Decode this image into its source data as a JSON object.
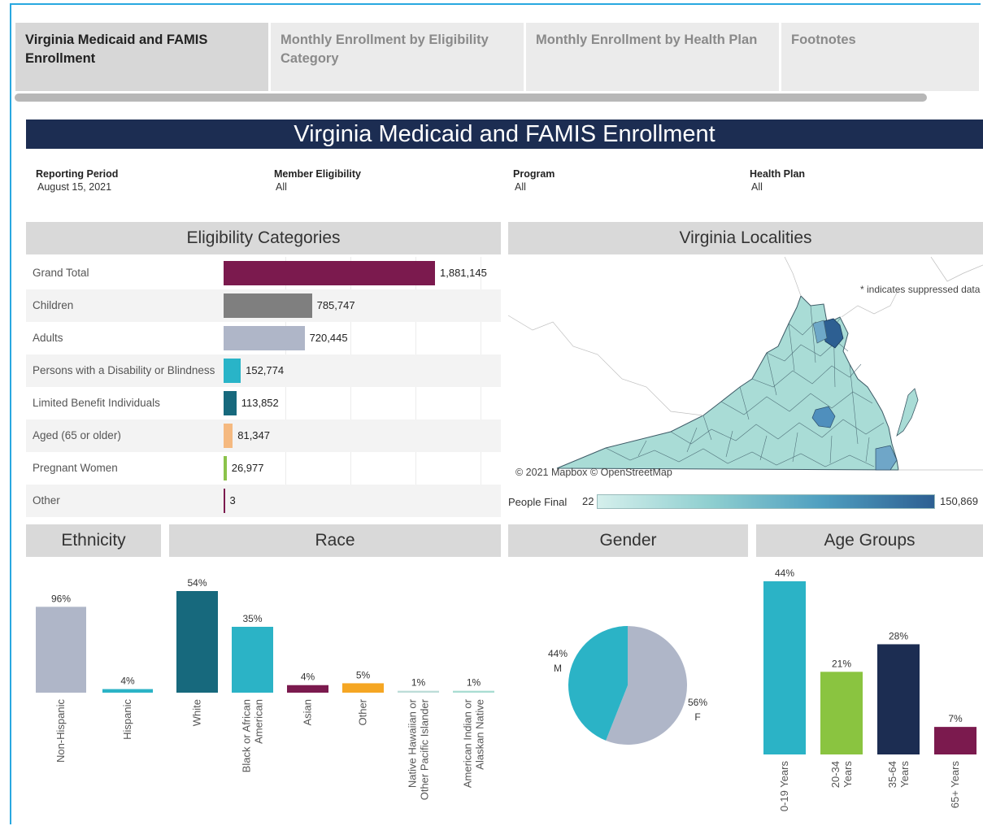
{
  "tabs": [
    {
      "label": "Virginia Medicaid and FAMIS Enrollment",
      "active": true
    },
    {
      "label": "Monthly Enrollment by Eligibility Category",
      "active": false
    },
    {
      "label": "Monthly Enrollment by Health Plan",
      "active": false
    },
    {
      "label": "Footnotes",
      "active": false
    }
  ],
  "title": "Virginia Medicaid and FAMIS Enrollment",
  "filters": [
    {
      "label": "Reporting Period",
      "value": "August 15, 2021"
    },
    {
      "label": "Member Eligibility",
      "value": "All"
    },
    {
      "label": "Program",
      "value": "All"
    },
    {
      "label": "Health Plan",
      "value": "All"
    }
  ],
  "sections": {
    "eligibility": "Eligibility Categories",
    "localities": "Virginia Localities",
    "ethnicity": "Ethnicity",
    "race": "Race",
    "gender": "Gender",
    "age": "Age Groups"
  },
  "colors": {
    "maroon": "#7b1a4e",
    "gray": "#7f7f7f",
    "lightslate": "#afb6c8",
    "cyan": "#29b4c8",
    "teal": "#17697d",
    "peach": "#f5b980",
    "green": "#8bc34a",
    "navy": "#1c2d52",
    "orange": "#f5a623",
    "bluegreen": "#2bb3c6",
    "grass": "#8ac440"
  },
  "eligibility": {
    "rows": [
      {
        "label": "Grand Total",
        "display": "1,881,145",
        "color": "#7b1a4e"
      },
      {
        "label": "Children",
        "display": "785,747",
        "color": "#7f7f7f"
      },
      {
        "label": "Adults",
        "display": "720,445",
        "color": "#afb6c8"
      },
      {
        "label": "Persons with a Disability or Blindness",
        "display": "152,774",
        "color": "#29b4c8"
      },
      {
        "label": "Limited Benefit Individuals",
        "display": "113,852",
        "color": "#17697d"
      },
      {
        "label": "Aged (65 or older)",
        "display": "81,347",
        "color": "#f5b980"
      },
      {
        "label": "Pregnant Women",
        "display": "26,977",
        "color": "#8bc34a"
      },
      {
        "label": "Other",
        "display": "3",
        "color": "#7b1a4e"
      }
    ]
  },
  "map": {
    "suppressed_note": "* indicates suppressed data",
    "credit": "© 2021 Mapbox © OpenStreetMap",
    "legend_label": "People Final",
    "legend_min": "22",
    "legend_max": "150,869"
  },
  "chart_data": [
    {
      "type": "bar",
      "title": "Eligibility Categories",
      "categories": [
        "Grand Total",
        "Children",
        "Adults",
        "Persons with a Disability or Blindness",
        "Limited Benefit Individuals",
        "Aged (65 or older)",
        "Pregnant Women",
        "Other"
      ],
      "values": [
        1881145,
        785747,
        720445,
        152774,
        113852,
        81347,
        26977,
        3
      ],
      "orientation": "horizontal"
    },
    {
      "type": "bar",
      "title": "Ethnicity",
      "categories": [
        "Non-Hispanic",
        "Hispanic"
      ],
      "values": [
        96,
        4
      ],
      "labels": [
        "96%",
        "4%"
      ],
      "colors": [
        "#afb6c8",
        "#2bb3c6"
      ]
    },
    {
      "type": "bar",
      "title": "Race",
      "categories": [
        "White",
        "Black or African American",
        "Asian",
        "Other",
        "Native Hawaiian or Other Pacific Islander",
        "American Indian or Alaskan Native"
      ],
      "values": [
        54,
        35,
        4,
        5,
        1,
        1
      ],
      "labels": [
        "54%",
        "35%",
        "4%",
        "5%",
        "1%",
        "1%"
      ],
      "colors": [
        "#17697d",
        "#2bb3c6",
        "#7b1a4e",
        "#f5a623",
        "#bcdcd8",
        "#a8dcd2"
      ]
    },
    {
      "type": "pie",
      "title": "Gender",
      "categories": [
        "M",
        "F"
      ],
      "values": [
        44,
        56
      ],
      "labels": [
        "44%",
        "56%"
      ],
      "colors": [
        "#2bb3c6",
        "#afb6c8"
      ]
    },
    {
      "type": "bar",
      "title": "Age Groups",
      "categories": [
        "0-19 Years",
        "20-34 Years",
        "35-64 Years",
        "65+ Years"
      ],
      "values": [
        44,
        21,
        28,
        7
      ],
      "labels": [
        "44%",
        "21%",
        "28%",
        "7%"
      ],
      "colors": [
        "#2bb3c6",
        "#8ac440",
        "#1c2d52",
        "#7b1a4e"
      ]
    }
  ]
}
